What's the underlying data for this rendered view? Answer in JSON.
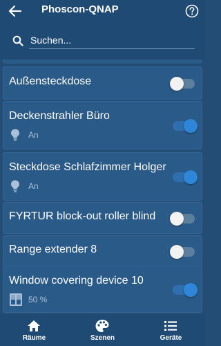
{
  "header": {
    "title": "Phoscon-QNAP"
  },
  "search": {
    "placeholder": "Suchen..."
  },
  "devices": [
    {
      "name": "Außensteckdose",
      "on": false
    },
    {
      "name": "Deckenstrahler Büro",
      "on": true,
      "status_icon": "bulb-icon",
      "status": "An"
    },
    {
      "name": "Steckdose Schlafzimmer Holger",
      "on": true,
      "status_icon": "bulb-icon",
      "status": "An"
    },
    {
      "name": "FYRTUR block-out roller blind",
      "on": false
    },
    {
      "name": "Range extender 8",
      "on": false
    },
    {
      "name": "Window covering device 10",
      "on": true,
      "status_icon": "window-covering-icon",
      "status": "50 %"
    }
  ],
  "nav": [
    {
      "label": "Räume",
      "icon": "home-icon"
    },
    {
      "label": "Szenen",
      "icon": "palette-icon"
    },
    {
      "label": "Geräte",
      "icon": "list-icon"
    }
  ],
  "colors": {
    "background": "#234d75",
    "card": "#2a5a88",
    "toggle_on": "#2f86d8",
    "toggle_off_knob": "#f2f2f2",
    "status_text": "#a9c0d8"
  }
}
